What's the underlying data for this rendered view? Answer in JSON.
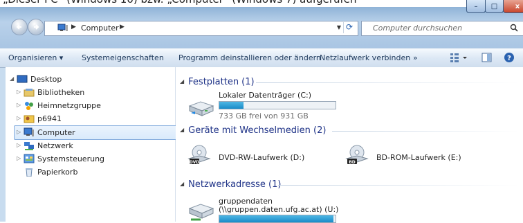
{
  "caption": {
    "text": "„Dieser PC“ (Windows 10) bzw. „Computer“ (Windows 7) aufgerufen"
  },
  "window_controls": {
    "minimize": "–",
    "maximize": "□",
    "close": "x"
  },
  "address_bar": {
    "crumbs": [
      "Computer"
    ],
    "search_placeholder": "Computer durchsuchen"
  },
  "toolbar": {
    "organize": "Organisieren ▾",
    "system_properties": "Systemeigenschaften",
    "uninstall": "Programm deinstallieren oder ändern",
    "map_drive": "Netzlaufwerk verbinden",
    "more": "»"
  },
  "nav_pane": {
    "items": [
      {
        "label": "Desktop",
        "icon": "desktop-icon"
      },
      {
        "label": "Bibliotheken",
        "icon": "libraries-icon"
      },
      {
        "label": "Heimnetzgruppe",
        "icon": "homegroup-icon"
      },
      {
        "label": "p6941",
        "icon": "user-folder-icon"
      },
      {
        "label": "Computer",
        "icon": "computer-icon",
        "selected": true
      },
      {
        "label": "Netzwerk",
        "icon": "network-icon"
      },
      {
        "label": "Systemsteuerung",
        "icon": "control-panel-icon"
      },
      {
        "label": "Papierkorb",
        "icon": "recycle-bin-icon"
      }
    ]
  },
  "content": {
    "groups": [
      {
        "title": "Festplatten (1)",
        "items": [
          {
            "name": "Lokaler Datenträger (C:)",
            "free_text": "733 GB frei von 931 GB",
            "used_fraction": 0.21,
            "icon": "hard-disk-icon"
          }
        ]
      },
      {
        "title": "Geräte mit Wechselmedien (2)",
        "items": [
          {
            "name": "DVD-RW-Laufwerk (D:)",
            "icon": "dvd-drive-icon",
            "badge": "DVD"
          },
          {
            "name": "BD-ROM-Laufwerk (E:)",
            "icon": "bd-drive-icon",
            "badge": "BD"
          }
        ]
      },
      {
        "title": "Netzwerkadresse (1)",
        "items": [
          {
            "name_line1": "gruppendaten",
            "name_line2": "(\\\\gruppen.daten.ufg.ac.at) (U:)",
            "used_fraction": 0.98,
            "icon": "network-drive-icon"
          }
        ]
      }
    ]
  },
  "colors": {
    "accent": "#1e3287",
    "bar_fill": "#1a8bc8",
    "selection": "#d9eafb"
  }
}
